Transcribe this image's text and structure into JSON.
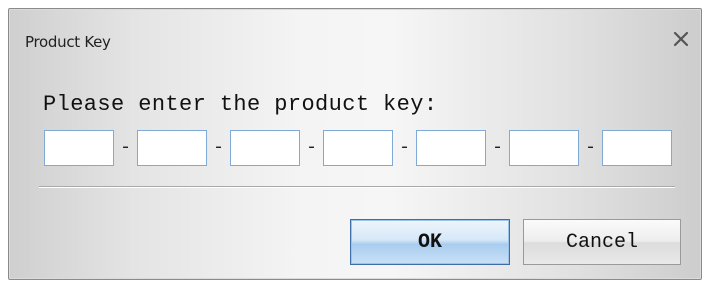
{
  "dialog": {
    "title": "Product Key",
    "close_icon": "close-icon",
    "prompt": "Please enter the product key:"
  },
  "key_fields": [
    {
      "value": "",
      "placeholder": ""
    },
    {
      "value": "",
      "placeholder": ""
    },
    {
      "value": "",
      "placeholder": ""
    },
    {
      "value": "",
      "placeholder": ""
    },
    {
      "value": "",
      "placeholder": ""
    },
    {
      "value": "",
      "placeholder": ""
    },
    {
      "value": "",
      "placeholder": ""
    }
  ],
  "separator": "-",
  "buttons": {
    "ok_label": "OK",
    "cancel_label": "Cancel"
  },
  "colors": {
    "field_border": "#7fa9d6",
    "ok_accent": "#a9cdef"
  }
}
